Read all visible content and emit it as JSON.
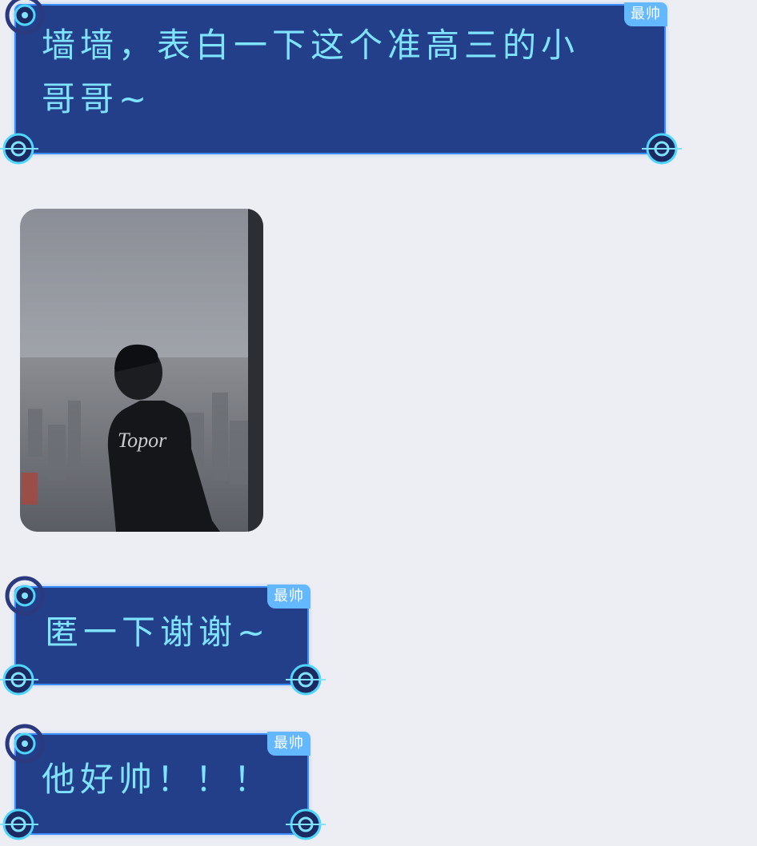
{
  "messages": [
    {
      "text": "墙墙，表白一下这个准高三的小\n哥哥~",
      "tag": "最帅"
    },
    {
      "text": "匿一下谢谢~",
      "tag": "最帅"
    },
    {
      "text": "他好帅！！！",
      "tag": "最帅"
    }
  ],
  "photo": {
    "shirt_text": "Topor",
    "colors": {
      "sky_top": "#8b8e96",
      "sky_bottom": "#b9bcc2",
      "city": "#6d7076",
      "window_frame": "#2c2e33"
    }
  },
  "colors": {
    "background": "#eceef3",
    "bubble_fill": "#243f8a",
    "bubble_border": "#3a8cff",
    "bubble_text": "#7fe3ff",
    "tag_fill": "#63b8ff"
  }
}
